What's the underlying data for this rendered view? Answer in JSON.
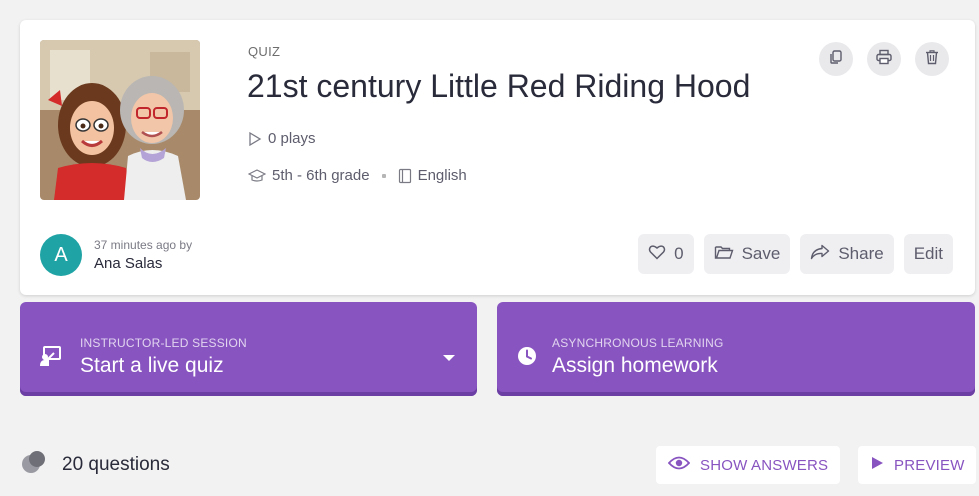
{
  "quiz": {
    "type_label": "QUIZ",
    "title": "21st century Little Red Riding Hood",
    "plays": "0 plays",
    "grade": "5th - 6th grade",
    "language": "English"
  },
  "author": {
    "initial": "A",
    "time": "37 minutes ago by",
    "name": "Ana Salas"
  },
  "actions": {
    "like_count": "0",
    "save_label": "Save",
    "share_label": "Share",
    "edit_label": "Edit"
  },
  "session": {
    "live_small": "INSTRUCTOR-LED SESSION",
    "live_big": "Start a live quiz",
    "hw_small": "ASYNCHRONOUS LEARNING",
    "hw_big": "Assign homework"
  },
  "questions": {
    "count_label": "20 questions",
    "show_answers_label": "SHOW ANSWERS",
    "preview_label": "PREVIEW"
  },
  "colors": {
    "accent": "#8854c0",
    "avatar": "#1fa3a5"
  },
  "icons": [
    "copy-icon",
    "print-icon",
    "trash-icon",
    "play-icon",
    "graduation-cap-icon",
    "book-icon",
    "heart-icon",
    "folder-icon",
    "share-icon",
    "presentation-icon",
    "clock-icon",
    "questions-icon",
    "eye-icon",
    "preview-play-icon"
  ]
}
